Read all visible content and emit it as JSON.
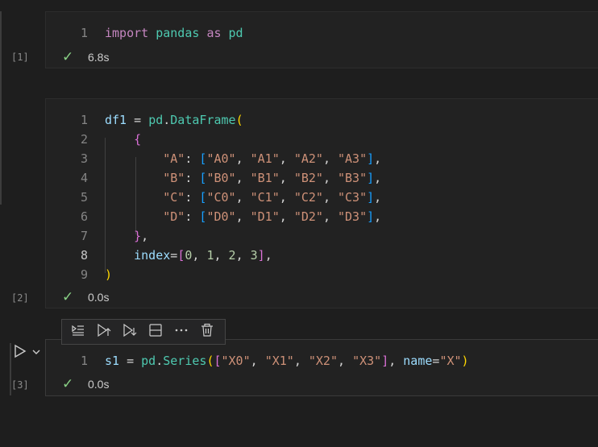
{
  "cells": [
    {
      "exec_count": "[1]",
      "status_time": "6.8s",
      "lines": [
        {
          "n": "1",
          "tokens": [
            {
              "c": "kw",
              "t": "import"
            },
            {
              "c": "pl",
              "t": " "
            },
            {
              "c": "mod",
              "t": "pandas"
            },
            {
              "c": "pl",
              "t": " "
            },
            {
              "c": "kw",
              "t": "as"
            },
            {
              "c": "pl",
              "t": " "
            },
            {
              "c": "mod",
              "t": "pd"
            }
          ]
        }
      ]
    },
    {
      "exec_count": "[2]",
      "status_time": "0.0s",
      "lines": [
        {
          "n": "1",
          "tokens": [
            {
              "c": "var",
              "t": "df1"
            },
            {
              "c": "pl",
              "t": " = "
            },
            {
              "c": "mod",
              "t": "pd"
            },
            {
              "c": "pl",
              "t": "."
            },
            {
              "c": "mod",
              "t": "DataFrame"
            },
            {
              "c": "b1",
              "t": "("
            }
          ]
        },
        {
          "n": "2",
          "tokens": [
            {
              "c": "pl",
              "t": "    "
            },
            {
              "c": "b2",
              "t": "{"
            }
          ]
        },
        {
          "n": "3",
          "tokens": [
            {
              "c": "pl",
              "t": "        "
            },
            {
              "c": "str",
              "t": "\"A\""
            },
            {
              "c": "pl",
              "t": ": "
            },
            {
              "c": "b3",
              "t": "["
            },
            {
              "c": "str",
              "t": "\"A0\""
            },
            {
              "c": "pl",
              "t": ", "
            },
            {
              "c": "str",
              "t": "\"A1\""
            },
            {
              "c": "pl",
              "t": ", "
            },
            {
              "c": "str",
              "t": "\"A2\""
            },
            {
              "c": "pl",
              "t": ", "
            },
            {
              "c": "str",
              "t": "\"A3\""
            },
            {
              "c": "b3",
              "t": "]"
            },
            {
              "c": "pl",
              "t": ","
            }
          ]
        },
        {
          "n": "4",
          "tokens": [
            {
              "c": "pl",
              "t": "        "
            },
            {
              "c": "str",
              "t": "\"B\""
            },
            {
              "c": "pl",
              "t": ": "
            },
            {
              "c": "b3",
              "t": "["
            },
            {
              "c": "str",
              "t": "\"B0\""
            },
            {
              "c": "pl",
              "t": ", "
            },
            {
              "c": "str",
              "t": "\"B1\""
            },
            {
              "c": "pl",
              "t": ", "
            },
            {
              "c": "str",
              "t": "\"B2\""
            },
            {
              "c": "pl",
              "t": ", "
            },
            {
              "c": "str",
              "t": "\"B3\""
            },
            {
              "c": "b3",
              "t": "]"
            },
            {
              "c": "pl",
              "t": ","
            }
          ]
        },
        {
          "n": "5",
          "tokens": [
            {
              "c": "pl",
              "t": "        "
            },
            {
              "c": "str",
              "t": "\"C\""
            },
            {
              "c": "pl",
              "t": ": "
            },
            {
              "c": "b3",
              "t": "["
            },
            {
              "c": "str",
              "t": "\"C0\""
            },
            {
              "c": "pl",
              "t": ", "
            },
            {
              "c": "str",
              "t": "\"C1\""
            },
            {
              "c": "pl",
              "t": ", "
            },
            {
              "c": "str",
              "t": "\"C2\""
            },
            {
              "c": "pl",
              "t": ", "
            },
            {
              "c": "str",
              "t": "\"C3\""
            },
            {
              "c": "b3",
              "t": "]"
            },
            {
              "c": "pl",
              "t": ","
            }
          ]
        },
        {
          "n": "6",
          "tokens": [
            {
              "c": "pl",
              "t": "        "
            },
            {
              "c": "str",
              "t": "\"D\""
            },
            {
              "c": "pl",
              "t": ": "
            },
            {
              "c": "b3",
              "t": "["
            },
            {
              "c": "str",
              "t": "\"D0\""
            },
            {
              "c": "pl",
              "t": ", "
            },
            {
              "c": "str",
              "t": "\"D1\""
            },
            {
              "c": "pl",
              "t": ", "
            },
            {
              "c": "str",
              "t": "\"D2\""
            },
            {
              "c": "pl",
              "t": ", "
            },
            {
              "c": "str",
              "t": "\"D3\""
            },
            {
              "c": "b3",
              "t": "]"
            },
            {
              "c": "pl",
              "t": ","
            }
          ]
        },
        {
          "n": "7",
          "tokens": [
            {
              "c": "pl",
              "t": "    "
            },
            {
              "c": "b2",
              "t": "}"
            },
            {
              "c": "pl",
              "t": ","
            }
          ]
        },
        {
          "n": "8",
          "current": true,
          "tokens": [
            {
              "c": "pl",
              "t": "    "
            },
            {
              "c": "var",
              "t": "index"
            },
            {
              "c": "pl",
              "t": "="
            },
            {
              "c": "b2",
              "t": "["
            },
            {
              "c": "num",
              "t": "0"
            },
            {
              "c": "pl",
              "t": ", "
            },
            {
              "c": "num",
              "t": "1"
            },
            {
              "c": "pl",
              "t": ", "
            },
            {
              "c": "num",
              "t": "2"
            },
            {
              "c": "pl",
              "t": ", "
            },
            {
              "c": "num",
              "t": "3"
            },
            {
              "c": "b2",
              "t": "]"
            },
            {
              "c": "pl",
              "t": ","
            }
          ]
        },
        {
          "n": "9",
          "tokens": [
            {
              "c": "b1",
              "t": ")"
            }
          ]
        }
      ]
    },
    {
      "exec_count": "[3]",
      "status_time": "0.0s",
      "lines": [
        {
          "n": "1",
          "tokens": [
            {
              "c": "var",
              "t": "s1"
            },
            {
              "c": "pl",
              "t": " = "
            },
            {
              "c": "mod",
              "t": "pd"
            },
            {
              "c": "pl",
              "t": "."
            },
            {
              "c": "mod",
              "t": "Series"
            },
            {
              "c": "b1",
              "t": "("
            },
            {
              "c": "b2",
              "t": "["
            },
            {
              "c": "str",
              "t": "\"X0\""
            },
            {
              "c": "pl",
              "t": ", "
            },
            {
              "c": "str",
              "t": "\"X1\""
            },
            {
              "c": "pl",
              "t": ", "
            },
            {
              "c": "str",
              "t": "\"X2\""
            },
            {
              "c": "pl",
              "t": ", "
            },
            {
              "c": "str",
              "t": "\"X3\""
            },
            {
              "c": "b2",
              "t": "]"
            },
            {
              "c": "pl",
              "t": ", "
            },
            {
              "c": "var",
              "t": "name"
            },
            {
              "c": "pl",
              "t": "="
            },
            {
              "c": "str",
              "t": "\"X\""
            },
            {
              "c": "b1",
              "t": ")"
            }
          ]
        }
      ]
    }
  ],
  "toolbar": {
    "icons": [
      "execute-above-icon",
      "run-above-icon",
      "run-below-icon",
      "split-cell-icon",
      "more-icon",
      "delete-icon"
    ]
  },
  "colors": {
    "background": "#1e1e1e",
    "cell": "#222222",
    "check": "#89d185"
  }
}
